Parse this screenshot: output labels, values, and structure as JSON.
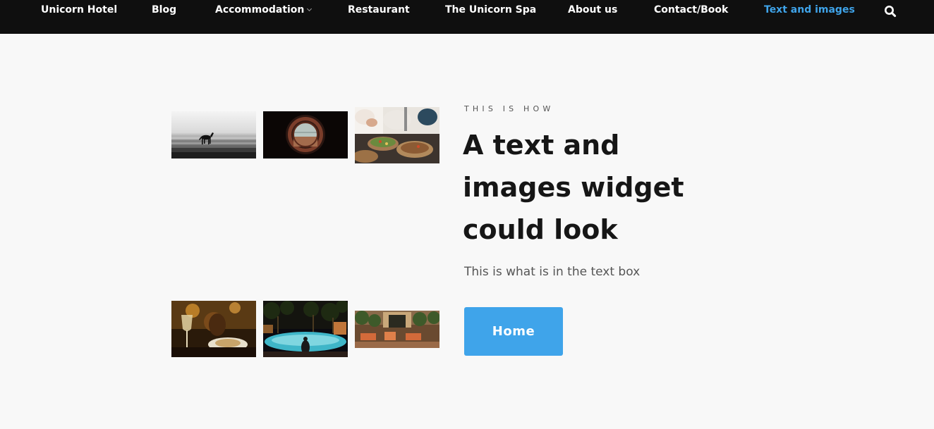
{
  "nav": {
    "items": [
      {
        "label": "Unicorn Hotel"
      },
      {
        "label": "Blog"
      },
      {
        "label": "Accommodation",
        "has_dropdown": true
      },
      {
        "label": "Restaurant"
      },
      {
        "label": "The Unicorn Spa"
      },
      {
        "label": "About us"
      },
      {
        "label": "Contact/Book"
      },
      {
        "label": "Text and images",
        "active": true
      }
    ],
    "search_icon": "search-icon"
  },
  "gallery": {
    "images": [
      "horse-on-beach-photo",
      "porthole-window-photo",
      "chef-plating-food-photo",
      "wine-glass-dinner-photo",
      "pool-at-night-photo",
      "courtyard-lounge-photo"
    ]
  },
  "content": {
    "eyebrow": "THIS IS HOW",
    "heading": "A text and images widget could look",
    "body": "This is what is in the text box",
    "button_label": "Home"
  },
  "colors": {
    "nav_background": "#0f0f0f",
    "accent": "#3fa4ea",
    "page_background": "#f8f8f8"
  }
}
